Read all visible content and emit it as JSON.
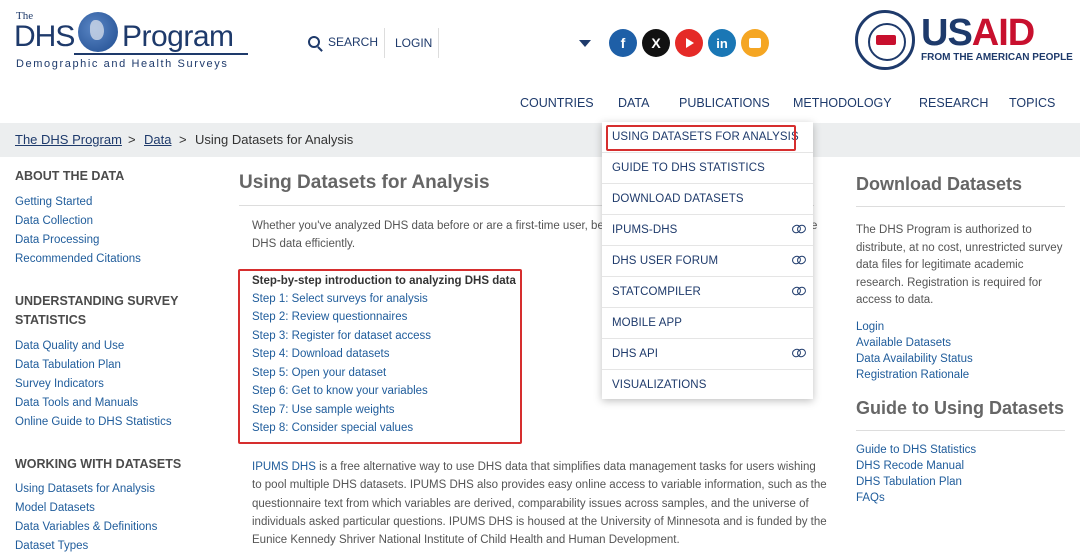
{
  "header": {
    "logo": {
      "the": "The",
      "dhs": "DHS",
      "program": "Program",
      "subtitle": "Demographic and Health Surveys"
    },
    "search_label": "SEARCH",
    "login_label": "LOGIN",
    "social": [
      {
        "name": "facebook-icon",
        "glyph": "f"
      },
      {
        "name": "x-icon",
        "glyph": "X"
      },
      {
        "name": "youtube-icon",
        "glyph": ""
      },
      {
        "name": "linkedin-icon",
        "glyph": "in"
      },
      {
        "name": "blog-icon",
        "glyph": ""
      }
    ],
    "usaid": {
      "us": "US",
      "aid": "AID",
      "tagline": "FROM THE AMERICAN PEOPLE",
      "seal_text": "USAID"
    }
  },
  "nav": {
    "items": [
      "COUNTRIES",
      "DATA",
      "PUBLICATIONS",
      "METHODOLOGY",
      "RESEARCH",
      "TOPICS"
    ]
  },
  "breadcrumb": {
    "home": "The DHS Program",
    "sep": ">",
    "data": "Data",
    "current": "Using Datasets for Analysis"
  },
  "sidebar": {
    "sections": [
      {
        "heading": "ABOUT THE DATA",
        "links": [
          "Getting Started",
          "Data Collection",
          "Data Processing",
          "Recommended Citations"
        ]
      },
      {
        "heading_line1": "UNDERSTANDING SURVEY",
        "heading_line2": "STATISTICS",
        "links": [
          "Data Quality and Use",
          "Data Tabulation Plan",
          "Survey Indicators",
          "Data Tools and Manuals",
          "Online Guide to DHS Statistics"
        ]
      },
      {
        "heading": "WORKING WITH DATASETS",
        "links": [
          "Using Datasets for Analysis",
          "Model Datasets",
          "Data Variables & Definitions",
          "Dataset Types"
        ]
      }
    ]
  },
  "main": {
    "title": "Using Datasets for Analysis",
    "intro_visible_1": "Whether you've analyzed DHS data before or are a first-time user, bel",
    "intro_visible_tail": "e",
    "intro_line2": "DHS data efficiently.",
    "steps_title": "Step-by-step introduction to analyzing DHS data",
    "steps": [
      "Step 1: Select surveys for analysis",
      "Step 2: Review questionnaires",
      "Step 3: Register for dataset access",
      "Step 4: Download datasets",
      "Step 5: Open your dataset",
      "Step 6: Get to know your variables",
      "Step 7: Use sample weights",
      "Step 8: Consider special values"
    ],
    "ipums_lead": "IPUMS DHS",
    "ipums_text": " is a free alternative way to use DHS data that simplifies data management tasks for users wishing to pool multiple DHS datasets. IPUMS DHS also provides easy online access to variable information, such as the questionnaire text from which variables are derived, comparability issues across samples, and the universe of individuals asked particular questions. IPUMS DHS is housed at the University of Minnesota and is funded by the Eunice Kennedy Shriver National Institute of Child Health and Human Development."
  },
  "right": {
    "download_heading": "Download Datasets",
    "download_text": "The DHS Program is authorized to distribute, at no cost, unrestricted survey data files for legitimate academic research. Registration is required for access to data.",
    "download_links": [
      "Login",
      "Available Datasets",
      "Data Availability Status",
      "Registration Rationale"
    ],
    "guide_heading": "Guide to Using Datasets",
    "guide_links": [
      "Guide to DHS Statistics",
      "DHS Recode Manual",
      "DHS Tabulation Plan",
      "FAQs"
    ]
  },
  "dropdown": {
    "items": [
      {
        "label": "USING DATASETS FOR ANALYSIS",
        "external": false
      },
      {
        "label": "GUIDE TO DHS STATISTICS",
        "external": false
      },
      {
        "label": "DOWNLOAD DATASETS",
        "external": false
      },
      {
        "label": "IPUMS-DHS",
        "external": true
      },
      {
        "label": "DHS USER FORUM",
        "external": true
      },
      {
        "label": "STATCOMPILER",
        "external": true
      },
      {
        "label": "MOBILE APP",
        "external": false
      },
      {
        "label": "DHS API",
        "external": true
      },
      {
        "label": "VISUALIZATIONS",
        "external": false
      }
    ]
  },
  "colors": {
    "brand_navy": "#1e3a6b",
    "link_blue": "#1f5c9b",
    "highlight_red": "#d62e2e",
    "usaid_red": "#c8102e"
  }
}
